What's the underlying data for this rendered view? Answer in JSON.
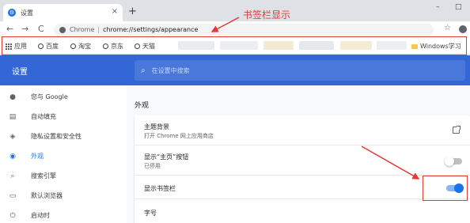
{
  "tab": {
    "title": "设置",
    "close_glyph": "×",
    "new_tab_glyph": "+"
  },
  "window_controls": {
    "minimize_glyph": "–",
    "maximize_glyph": "□"
  },
  "toolbar": {
    "back_glyph": "←",
    "forward_glyph": "→",
    "reload_glyph": "C",
    "url_scheme": "Chrome",
    "url_separator": "|",
    "url_path": "chrome://settings/appearance",
    "star_glyph": "☆"
  },
  "bookmarks": {
    "items": [
      {
        "label": "应用",
        "icon": "apps-icon"
      },
      {
        "label": "百度",
        "icon": "globe-icon"
      },
      {
        "label": "淘宝",
        "icon": "globe-icon"
      },
      {
        "label": "京东",
        "icon": "globe-icon"
      },
      {
        "label": "天猫",
        "icon": "globe-icon"
      }
    ],
    "folder": {
      "label": "Windows学习",
      "icon": "folder-icon"
    }
  },
  "annotation": {
    "text": "书签栏显示",
    "color": "#e53935"
  },
  "settings": {
    "title": "设置",
    "search_placeholder": "在设置中搜索",
    "search_glyph": "⌕",
    "header_color": "#3367d6"
  },
  "sidebar": {
    "items": [
      {
        "label": "您与 Google",
        "icon": "person-icon",
        "glyph": "●"
      },
      {
        "label": "自动填充",
        "icon": "clipboard-icon",
        "glyph": "▤"
      },
      {
        "label": "隐私设置和安全性",
        "icon": "shield-icon",
        "glyph": "◈"
      },
      {
        "label": "外观",
        "icon": "palette-icon",
        "glyph": "◉",
        "active": true
      },
      {
        "label": "搜索引擎",
        "icon": "search-icon",
        "glyph": "⌕"
      },
      {
        "label": "默认浏览器",
        "icon": "browser-icon",
        "glyph": "▭"
      },
      {
        "label": "启动时",
        "icon": "power-icon",
        "glyph": "⏻"
      }
    ]
  },
  "main": {
    "section_title": "外观",
    "rows": [
      {
        "title": "主题背景",
        "subtitle": "打开 Chrome 网上应用商店",
        "control": "external-link"
      },
      {
        "title": "显示“主页”按钮",
        "subtitle": "已停用",
        "control": "toggle",
        "enabled": false
      },
      {
        "title": "显示书签栏",
        "control": "toggle",
        "enabled": true
      },
      {
        "title": "字号"
      }
    ]
  },
  "colors": {
    "accent": "#1a73e8",
    "annotation": "#e53935"
  }
}
